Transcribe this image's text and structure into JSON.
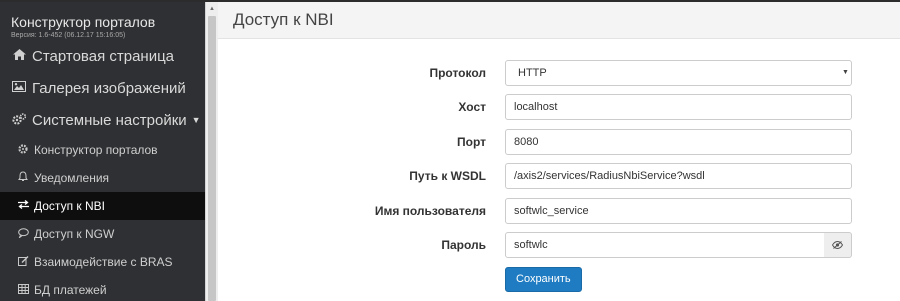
{
  "app": {
    "title": "Конструктор порталов",
    "version": "Версия: 1.6-452 (06.12.17 15:16:05)"
  },
  "sidebar": {
    "items": [
      {
        "label": "Стартовая страница",
        "icon": "home-icon"
      },
      {
        "label": "Галерея изображений",
        "icon": "image-icon"
      },
      {
        "label": "Системные настройки",
        "icon": "cogs-icon",
        "expanded": true
      }
    ],
    "subitems": [
      {
        "label": "Конструктор порталов",
        "icon": "cog-icon"
      },
      {
        "label": "Уведомления",
        "icon": "bell-icon"
      },
      {
        "label": "Доступ к NBI",
        "icon": "exchange-icon",
        "active": true
      },
      {
        "label": "Доступ к NGW",
        "icon": "comment-icon"
      },
      {
        "label": "Взаимодействие с BRAS",
        "icon": "edit-icon"
      },
      {
        "label": "БД платежей",
        "icon": "table-icon"
      }
    ]
  },
  "page": {
    "title": "Доступ к NBI"
  },
  "form": {
    "protocol": {
      "label": "Протокол",
      "value": "HTTP",
      "options": [
        "HTTP"
      ]
    },
    "host": {
      "label": "Хост",
      "value": "localhost"
    },
    "port": {
      "label": "Порт",
      "value": "8080"
    },
    "wsdl_path": {
      "label": "Путь к WSDL",
      "value": "/axis2/services/RadiusNbiService?wsdl"
    },
    "username": {
      "label": "Имя пользователя",
      "value": "softwlc_service"
    },
    "password": {
      "label": "Пароль",
      "value": "softwlc"
    },
    "save_label": "Сохранить"
  },
  "colors": {
    "sidebar_bg": "#2f3033",
    "active_item_bg": "#0e0e0e",
    "primary_button": "#1f7cc2"
  }
}
